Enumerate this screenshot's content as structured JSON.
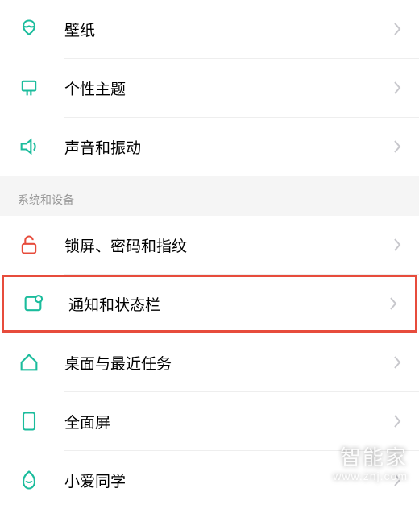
{
  "group1": {
    "items": [
      {
        "label": "壁纸",
        "icon": "wallpaper-icon",
        "color": "#1abc9c"
      },
      {
        "label": "个性主题",
        "icon": "theme-icon",
        "color": "#1abc9c"
      },
      {
        "label": "声音和振动",
        "icon": "sound-icon",
        "color": "#1abc9c"
      }
    ]
  },
  "section_header": "系统和设备",
  "group2": {
    "items": [
      {
        "label": "锁屏、密码和指纹",
        "icon": "lock-icon",
        "color": "#e74c3c",
        "highlighted": false
      },
      {
        "label": "通知和状态栏",
        "icon": "notification-icon",
        "color": "#1abc9c",
        "highlighted": true
      },
      {
        "label": "桌面与最近任务",
        "icon": "home-icon",
        "color": "#1abc9c",
        "highlighted": false
      },
      {
        "label": "全面屏",
        "icon": "fullscreen-icon",
        "color": "#1abc9c",
        "highlighted": false
      },
      {
        "label": "小爱同学",
        "icon": "ai-icon",
        "color": "#1abc9c",
        "highlighted": false
      }
    ]
  },
  "watermark": {
    "line1": "智能家",
    "line2": "www.znj.com"
  }
}
